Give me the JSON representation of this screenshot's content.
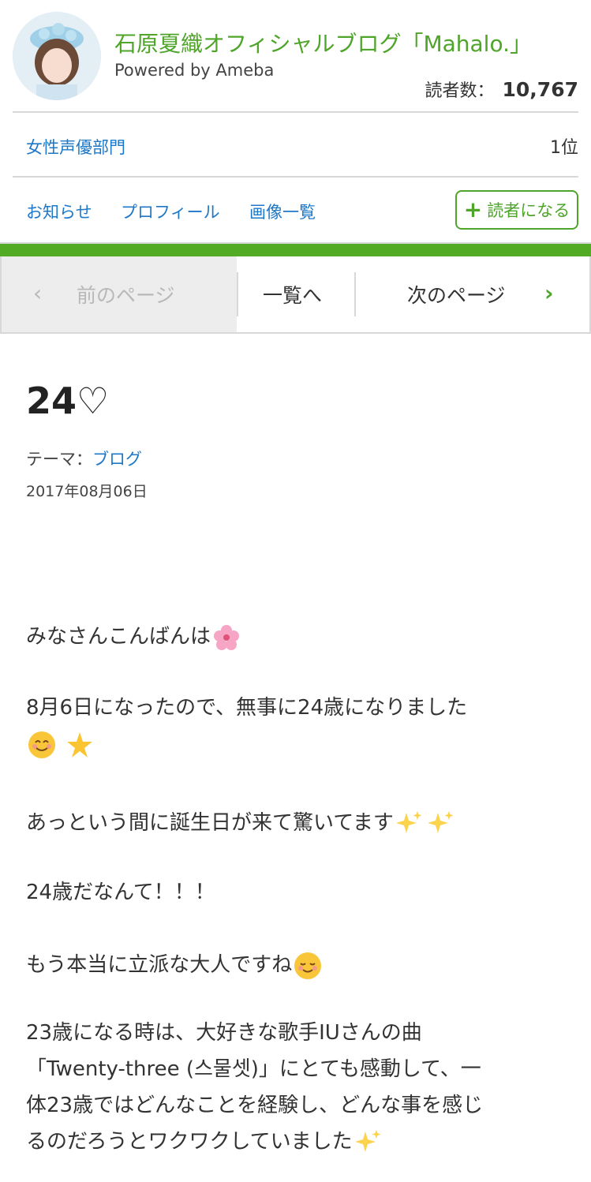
{
  "header": {
    "blog_title": "石原夏織オフィシャルブログ「Mahalo.」",
    "powered_by": "Powered by Ameba",
    "readers_label": "読者数：",
    "readers_count": "10,767"
  },
  "ranking": {
    "category": "女性声優部門",
    "rank": "1位"
  },
  "nav": {
    "news": "お知らせ",
    "profile": "プロフィール",
    "images": "画像一覧",
    "follow": "読者になる"
  },
  "pager": {
    "prev": "前のページ",
    "list": "一覧へ",
    "next": "次のページ"
  },
  "entry": {
    "title": "24♡",
    "theme_label": "テーマ：",
    "theme": "ブログ",
    "date": "2017年08月06日",
    "p1": "みなさんこんばんは",
    "p2": "8月6日になったので、無事に24歳になりました",
    "p3": "あっという間に誕生日が来て驚いてます",
    "p4": "24歳だなんて！！！",
    "p5": "もう本当に立派な大人ですね",
    "p6a": "23歳になる時は、大好きな歌手IUさんの曲",
    "p6b": "「Twenty-three (스물셋)」にとても感動して、一",
    "p6c": "体23歳ではどんなことを経験し、どんな事を感じ",
    "p6d": "るのだろうとワクワクしていました"
  },
  "colors": {
    "brand_green": "#4ea52a",
    "link_blue": "#1e78c8"
  },
  "icons": [
    "avatar",
    "plus-icon",
    "chevron-left-icon",
    "chevron-right-icon",
    "cherry-blossom-emoji",
    "smile-emoji",
    "star-emoji",
    "sparkles-emoji",
    "relieved-emoji"
  ]
}
